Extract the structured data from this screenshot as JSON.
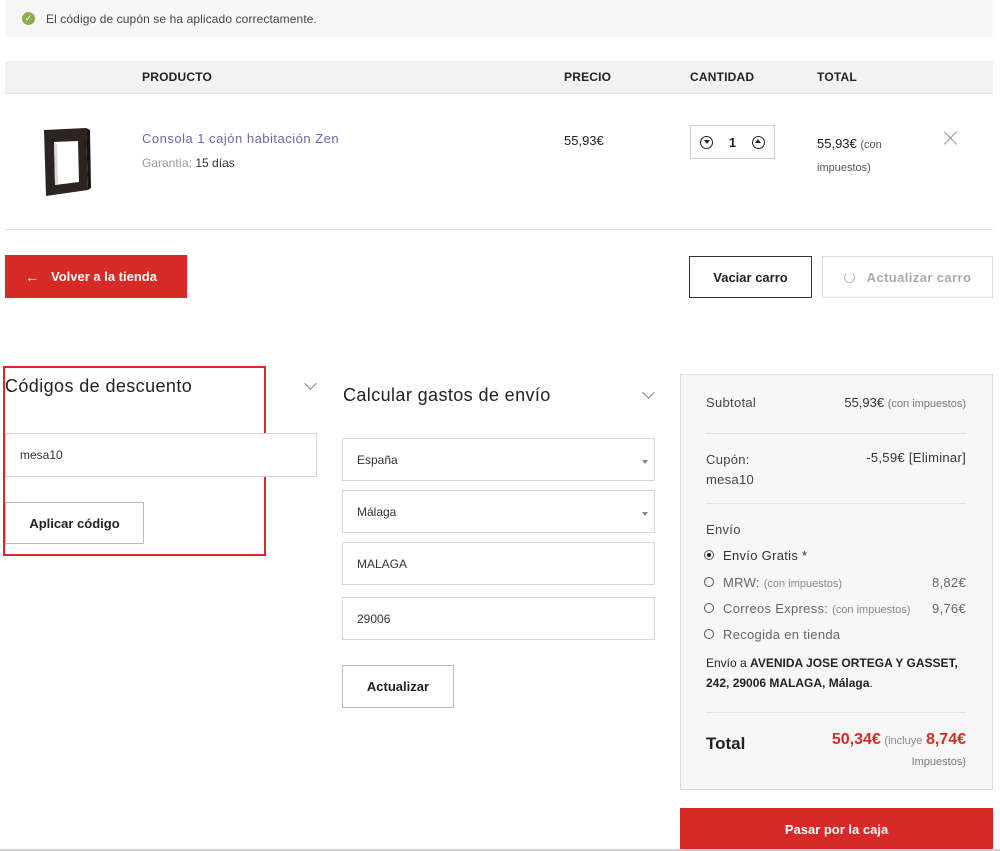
{
  "notice": {
    "message": "El código de cupón se ha aplicado correctamente."
  },
  "table": {
    "headers": {
      "product": "PRODUCTO",
      "price": "PRECIO",
      "quantity": "CANTIDAD",
      "total": "TOTAL"
    },
    "row": {
      "name": "Consola 1 cajón habitación Zen",
      "warranty_label": "Garantía:",
      "warranty_value": "15 días",
      "price": "55,93€",
      "quantity": "1",
      "total": "55,93€",
      "total_note": "(con impuestos)"
    }
  },
  "actions": {
    "back": "Volver a la tienda",
    "empty": "Vaciar carro",
    "update": "Actualizar carro"
  },
  "discount": {
    "title": "Códigos de descuento",
    "code_value": "mesa10",
    "apply": "Aplicar código"
  },
  "shipping_calc": {
    "title": "Calcular gastos de envío",
    "country": "España",
    "province": "Málaga",
    "city": "MALAGA",
    "postcode": "29006",
    "update": "Actualizar"
  },
  "totals": {
    "subtotal_label": "Subtotal",
    "subtotal_value": "55,93€",
    "subtotal_note": "(con impuestos)",
    "coupon_label": "Cupón:",
    "coupon_code": "mesa10",
    "coupon_value": "-5,59€",
    "coupon_remove": "[Eliminar]",
    "shipping_label": "Envío",
    "options": [
      {
        "label": "Envío Gratis *",
        "note": "",
        "price": "",
        "selected": true
      },
      {
        "label": "MRW:",
        "note": "(con impuestos)",
        "price": "8,82€",
        "selected": false
      },
      {
        "label": "Correos Express:",
        "note": "(con impuestos)",
        "price": "9,76€",
        "selected": false
      },
      {
        "label": "Recogida en tienda",
        "note": "",
        "price": "",
        "selected": false
      }
    ],
    "ship_to_prefix": "Envío a",
    "ship_to_address": "AVENIDA JOSE ORTEGA Y GASSET, 242, 29006 MALAGA, Málaga",
    "total_label": "Total",
    "total_value": "50,34€",
    "total_includes": "(incluye",
    "tax_value": "8,74€",
    "tax_label": "Impuestos)"
  },
  "checkout": "Pasar por la caja",
  "colors": {
    "accent": "#d52a25",
    "success": "#8bb04b",
    "link": "#7a62a8"
  }
}
